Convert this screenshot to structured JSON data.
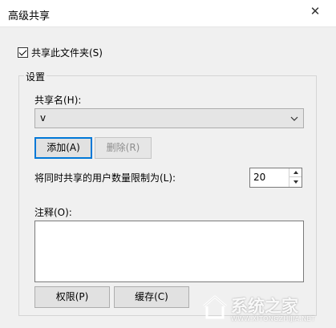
{
  "window": {
    "title": "高级共享",
    "close_glyph": "✕"
  },
  "share_checkbox": {
    "label": "共享此文件夹(S)",
    "checked": true
  },
  "settings": {
    "group_title": "设置",
    "share_name_label": "共享名(H):",
    "share_name_value": "v",
    "add_button": "添加(A)",
    "remove_button": "删除(R)",
    "user_limit_label": "将同时共享的用户数量限制为(L):",
    "user_limit_value": "20",
    "comments_label": "注释(O):",
    "comments_value": ""
  },
  "buttons": {
    "permissions": "权限(P)",
    "caching": "缓存(C)"
  },
  "watermark": {
    "text": "系统之家",
    "url": "WWW.XITONGZHIJIA.NET"
  },
  "colors": {
    "window_bg": "#f0f0f0",
    "focus_border": "#0078d7"
  }
}
